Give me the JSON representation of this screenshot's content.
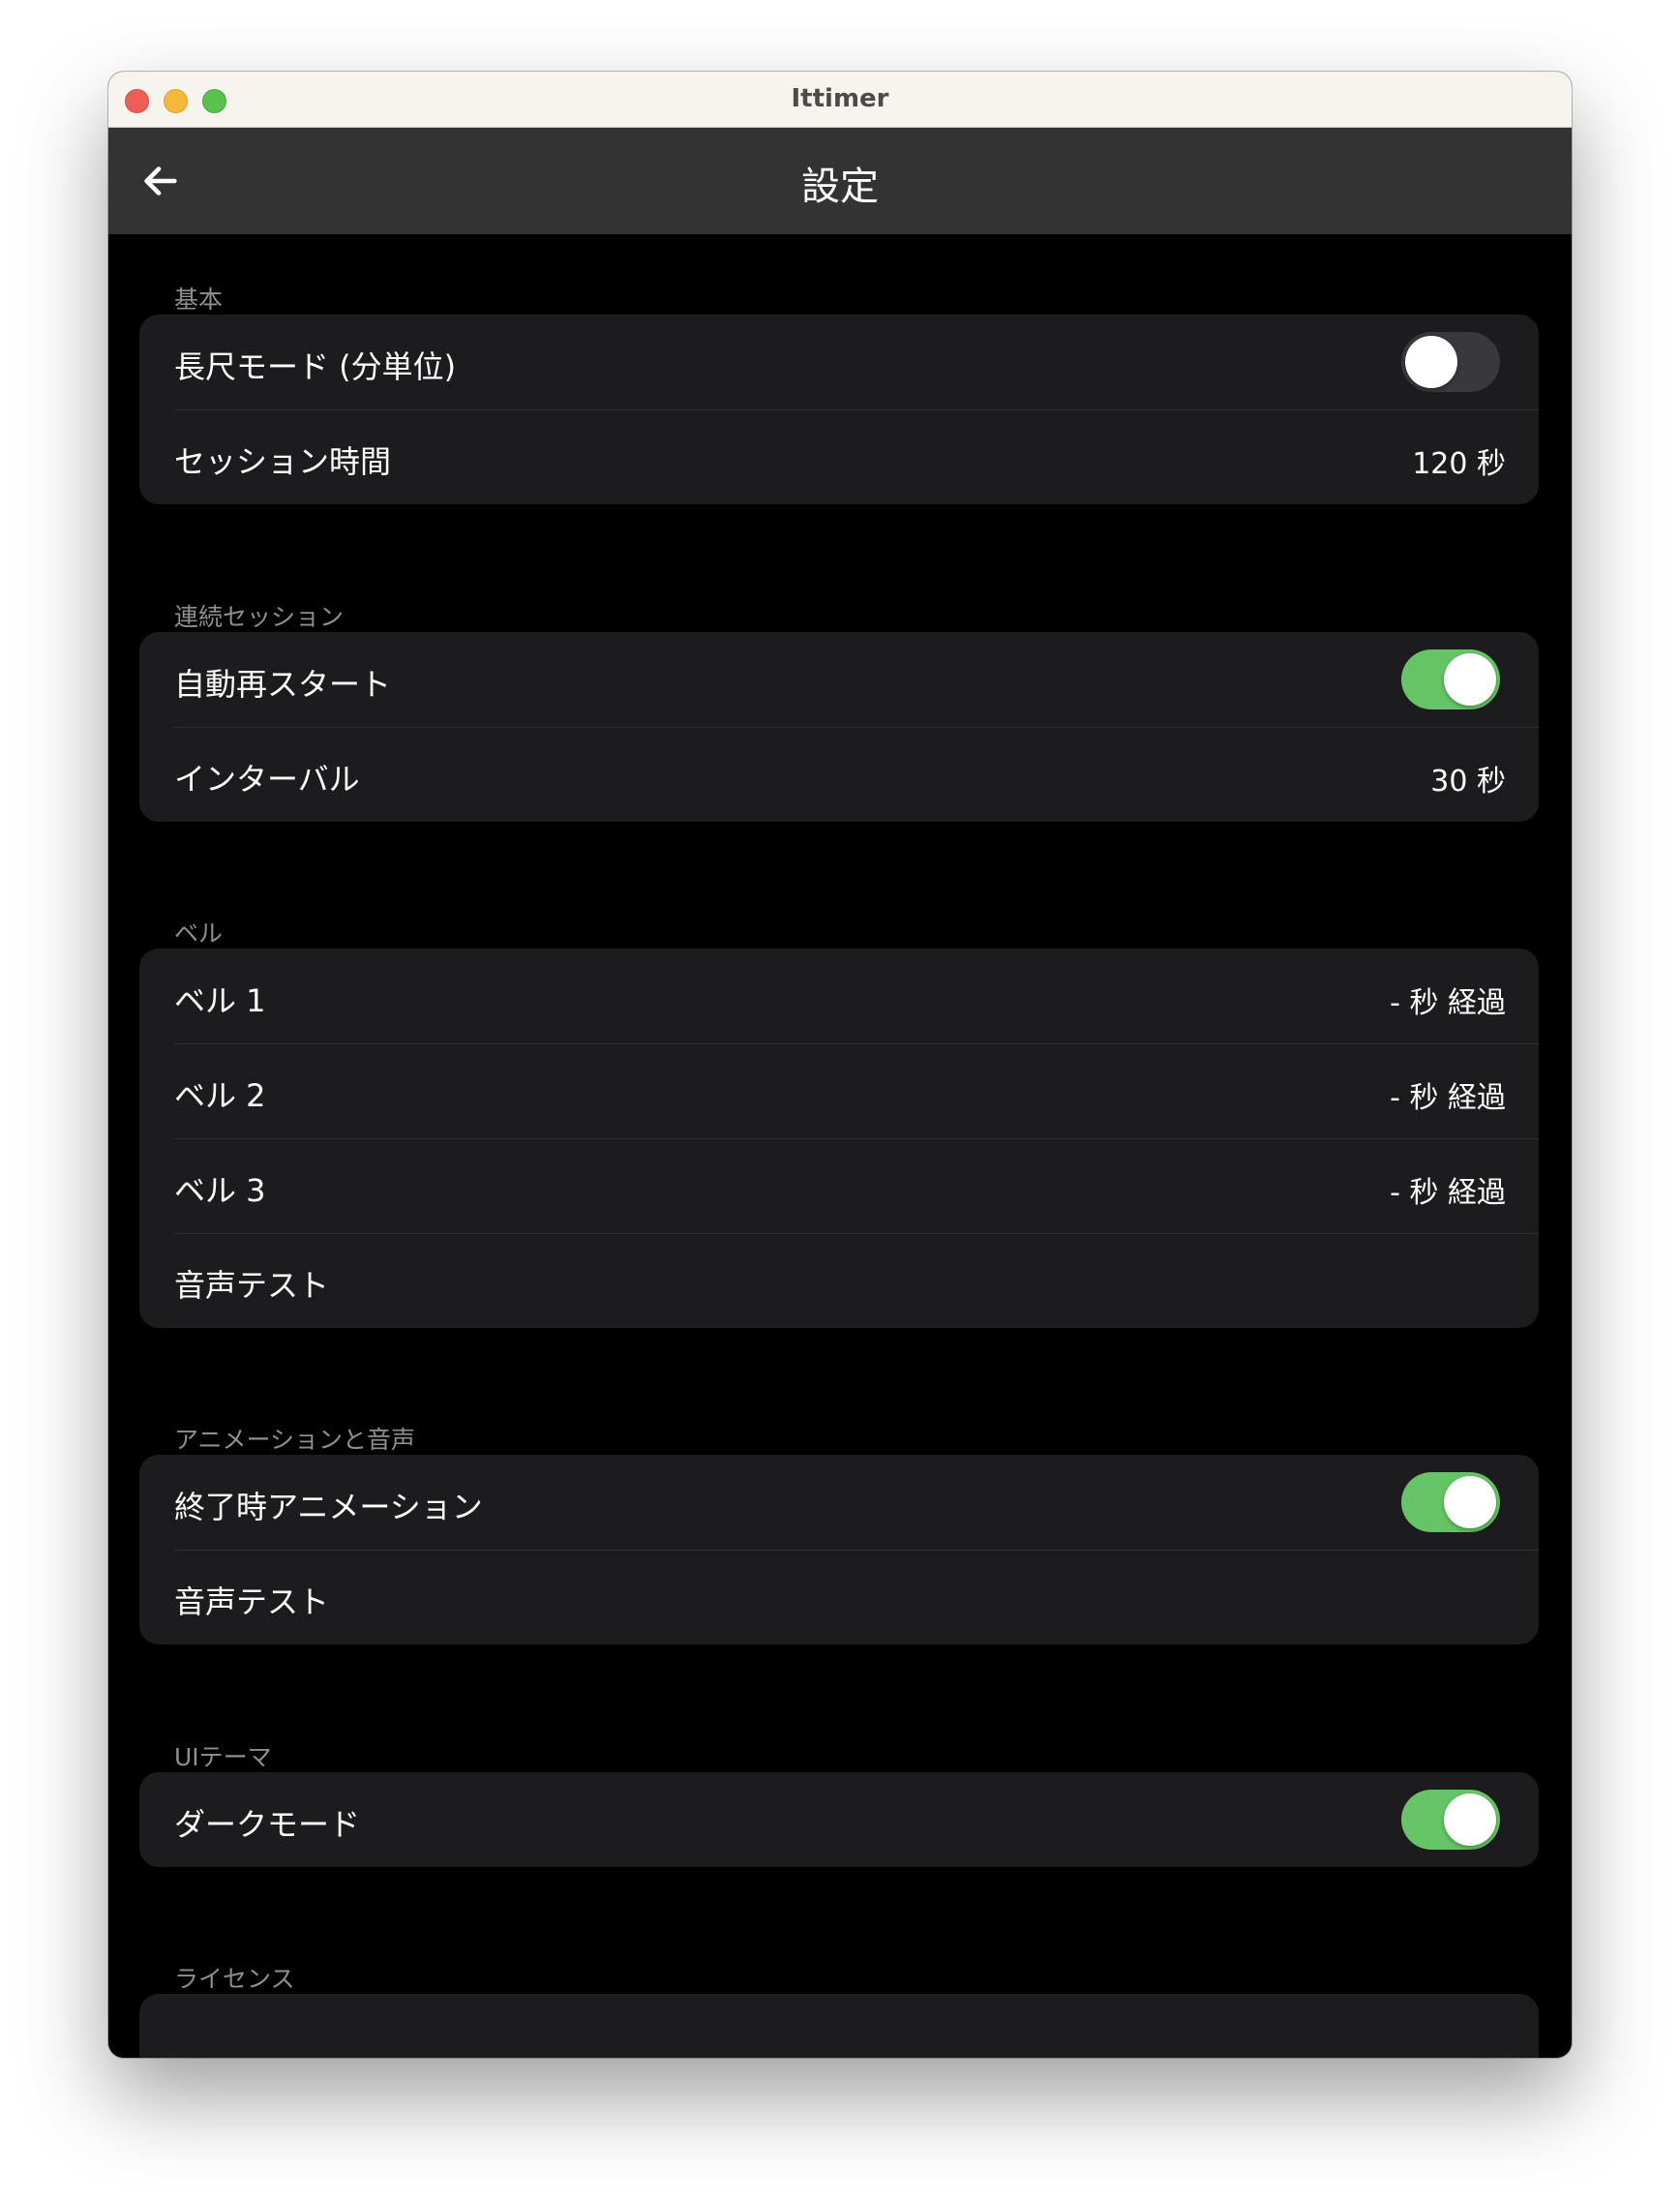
{
  "window": {
    "title": "Ittimer"
  },
  "appbar": {
    "title": "設定"
  },
  "sections": {
    "basic": {
      "header": "基本",
      "long_mode": {
        "label": "長尺モード (分単位)",
        "on": false
      },
      "session_time": {
        "label": "セッション時間",
        "value": "120 秒"
      }
    },
    "continuous": {
      "header": "連続セッション",
      "auto_restart": {
        "label": "自動再スタート",
        "on": true
      },
      "interval": {
        "label": "インターバル",
        "value": "30 秒"
      }
    },
    "bell": {
      "header": "ベル",
      "items": [
        {
          "label": "ベル 1",
          "value": "- 秒 経過"
        },
        {
          "label": "ベル 2",
          "value": "- 秒 経過"
        },
        {
          "label": "ベル 3",
          "value": "- 秒 経過"
        }
      ],
      "sound_test": "音声テスト"
    },
    "animation": {
      "header": "アニメーションと音声",
      "end_animation": {
        "label": "終了時アニメーション",
        "on": true
      },
      "sound_test": "音声テスト"
    },
    "theme": {
      "header": "UIテーマ",
      "dark_mode": {
        "label": "ダークモード",
        "on": true
      }
    },
    "license": {
      "header": "ライセンス"
    }
  },
  "colors": {
    "toggle_on": "#65c466",
    "toggle_off": "#39393d",
    "card_bg": "#1c1c1e",
    "appbar_bg": "#333333"
  }
}
